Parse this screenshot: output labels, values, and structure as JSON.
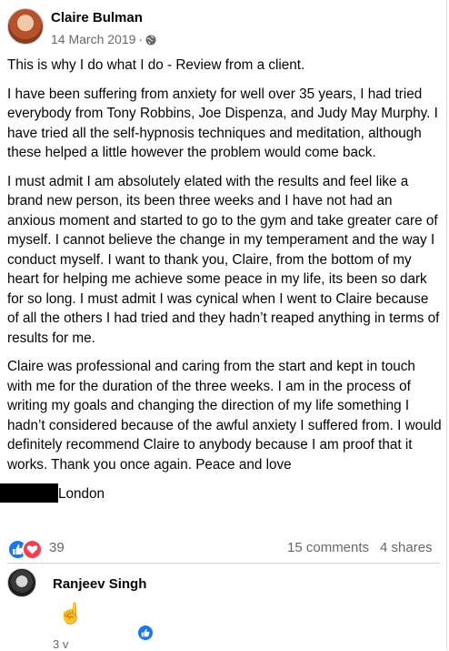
{
  "post": {
    "author": "Claire Bulman",
    "date": "14 March 2019",
    "separator": "·",
    "privacy_icon": "globe-icon",
    "paragraphs": [
      "This is why I do what I do - Review from a client.",
      "I have been suffering from anxiety for well over 35 years, I had tried everybody from Tony Robbins, Joe Dispenza, and Judy May Murphy. I have tried all the self-hypnosis techniques and meditation, although these helped a little however the problem would come back.",
      "I must admit I am absolutely elated with the results and feel like a brand new person, its been three weeks and I have not had an anxious moment and started to go to the gym and take greater care of myself. I cannot believe the change in my temperament and the way I conduct myself. I want to thank you, Claire, from the bottom of my heart for helping me achieve some peace in my life, its been so dark for so long. I must admit I was cynical when I went to Claire because of all the others I had tried and they hadn’t reaped anything in terms of results for me.",
      "Claire was professional and caring from the start and kept in touch with me for the duration of the three weeks. I am in the process of writing my goals and changing the direction of my life something I hadn’t considered because of the awful anxiety I suffered from. I would definitely recommend Claire to anybody because I am proof that it works. Thank you once again. Peace and love"
    ],
    "signature_location": "London"
  },
  "stats": {
    "reaction_icons": [
      "like-icon",
      "love-icon"
    ],
    "reaction_count": "39",
    "comments": "15 comments",
    "shares": "4 shares"
  },
  "comment": {
    "author": "Ranjeev Singh",
    "emoji": "☝️",
    "time": "3 v",
    "reaction_icon": "like-icon"
  },
  "colors": {
    "like_blue": "#1877f2",
    "love_red": "#f33e58",
    "secondary_text": "#65676b"
  }
}
